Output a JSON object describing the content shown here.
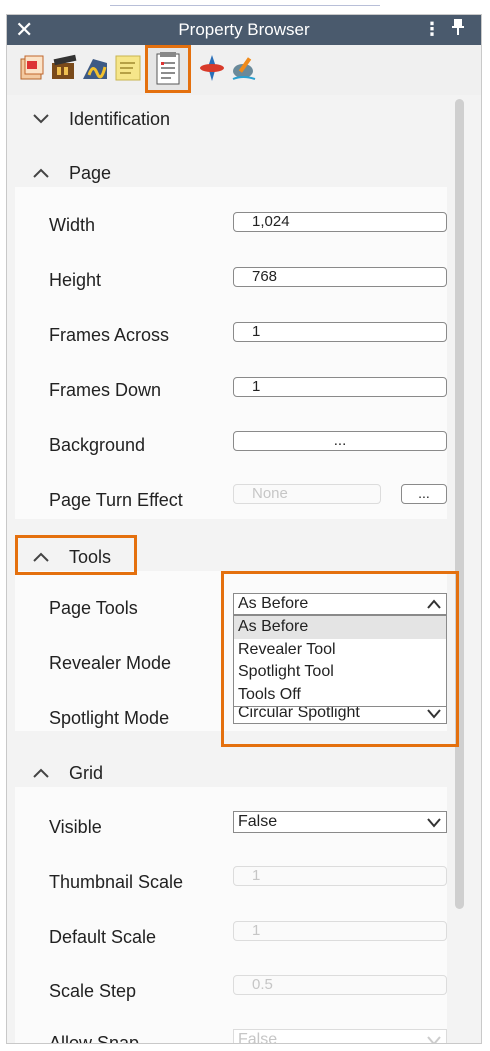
{
  "window": {
    "title": "Property Browser",
    "close_glyph": "✕",
    "menu_glyph": "⋮",
    "pin_glyph": "📌"
  },
  "toolbar": {
    "icons": [
      "page-properties-icon",
      "media-icon",
      "handwriting-icon",
      "notes-icon",
      "page-document-icon",
      "spinner-icon",
      "pen-tool-icon"
    ],
    "selected": "page-document-icon"
  },
  "groups": {
    "identification": {
      "label": "Identification",
      "expanded": false
    },
    "page": {
      "label": "Page",
      "expanded": true,
      "width_label": "Width",
      "width_value": "1,024",
      "height_label": "Height",
      "height_value": "768",
      "frames_across_label": "Frames Across",
      "frames_across_value": "1",
      "frames_down_label": "Frames Down",
      "frames_down_value": "1",
      "background_label": "Background",
      "background_value": "...",
      "page_turn_label": "Page Turn Effect",
      "page_turn_value": "None",
      "page_turn_button": "..."
    },
    "tools": {
      "label": "Tools",
      "expanded": true,
      "page_tools_label": "Page Tools",
      "page_tools_value": "As Before",
      "page_tools_options": [
        "As Before",
        "Revealer Tool",
        "Spotlight Tool",
        "Tools Off"
      ],
      "revealer_mode_label": "Revealer Mode",
      "spotlight_mode_label": "Spotlight Mode",
      "spotlight_mode_value": "Circular Spotlight"
    },
    "grid": {
      "label": "Grid",
      "expanded": true,
      "visible_label": "Visible",
      "visible_value": "False",
      "thumb_label": "Thumbnail Scale",
      "thumb_value": "1",
      "default_scale_label": "Default Scale",
      "default_scale_value": "1",
      "scale_step_label": "Scale Step",
      "scale_step_value": "0.5",
      "allow_snap_label": "Allow Snap",
      "allow_snap_value": "False"
    }
  },
  "colors": {
    "titlebar": "#4a5a6d",
    "highlight": "#e4700e"
  }
}
